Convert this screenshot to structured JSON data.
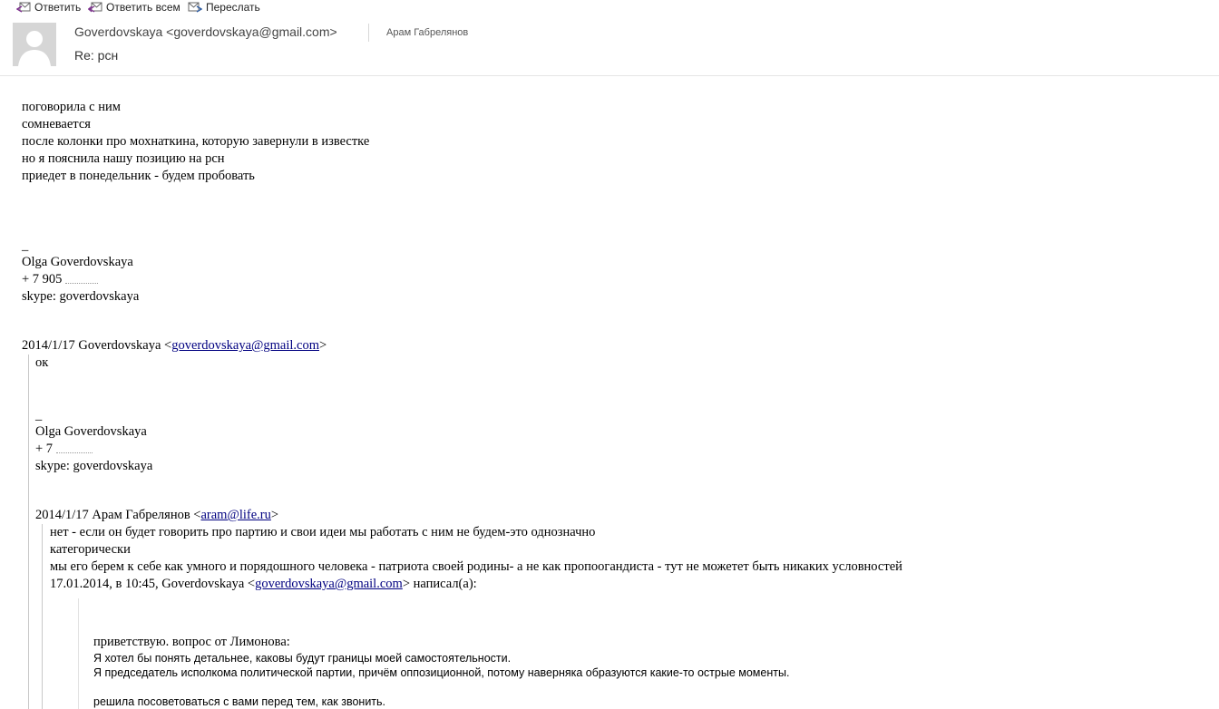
{
  "toolbar": {
    "reply": "Ответить",
    "reply_all": "Ответить всем",
    "forward": "Переслать"
  },
  "header": {
    "sender": "Goverdovskaya <goverdovskaya@gmail.com>",
    "recipient": "Арам Габрелянов",
    "subject": "Re: рсн"
  },
  "body": {
    "lines": [
      "поговорила с ним",
      "сомневается",
      "после колонки про мохнаткина, которую завернули в известке",
      "но я пояснила нашу позицию на рсн",
      "приедет в понедельник - будем пробовать"
    ],
    "sig_dash": "_",
    "sig_name": "Olga Goverdovskaya",
    "sig_phone": "+ 7 905 ",
    "sig_skype": "skype: goverdovskaya"
  },
  "quote1": {
    "intro_prefix": "2014/1/17 Goverdovskaya <",
    "intro_email": "goverdovskaya@gmail.com",
    "intro_suffix": ">",
    "text": "ок",
    "sig_dash": "_",
    "sig_name": "Olga Goverdovskaya",
    "sig_phone": "+ 7 ",
    "sig_skype": "skype: goverdovskaya"
  },
  "quote2": {
    "intro_prefix": "2014/1/17 Арам Габрелянов <",
    "intro_email": "aram@life.ru",
    "intro_suffix": ">",
    "lines": [
      "нет - если он будет говорить про партию и свои идеи мы работать с ним не будем-это однозначно",
      "категорически",
      "мы его берем к себе как умного и порядошного человека - патриота своей родины- а не как пропоогандиста - тут не можетет быть никаких условностей"
    ],
    "reply_prefix": "17.01.2014, в 10:45, Goverdovskaya <",
    "reply_email": "goverdovskaya@gmail.com",
    "reply_suffix": "> написал(а):"
  },
  "quote3": {
    "greeting": "приветствую. вопрос от Лимонова:",
    "line1": "Я хотел бы понять детальнее, каковы будут границы моей самостоятельности.",
    "line2": "Я председатель исполкома политической партии, причём оппозиционной, потому наверняка образуются какие-то острые моменты.",
    "line3": "решила посоветоваться с вами перед тем, как звонить."
  }
}
